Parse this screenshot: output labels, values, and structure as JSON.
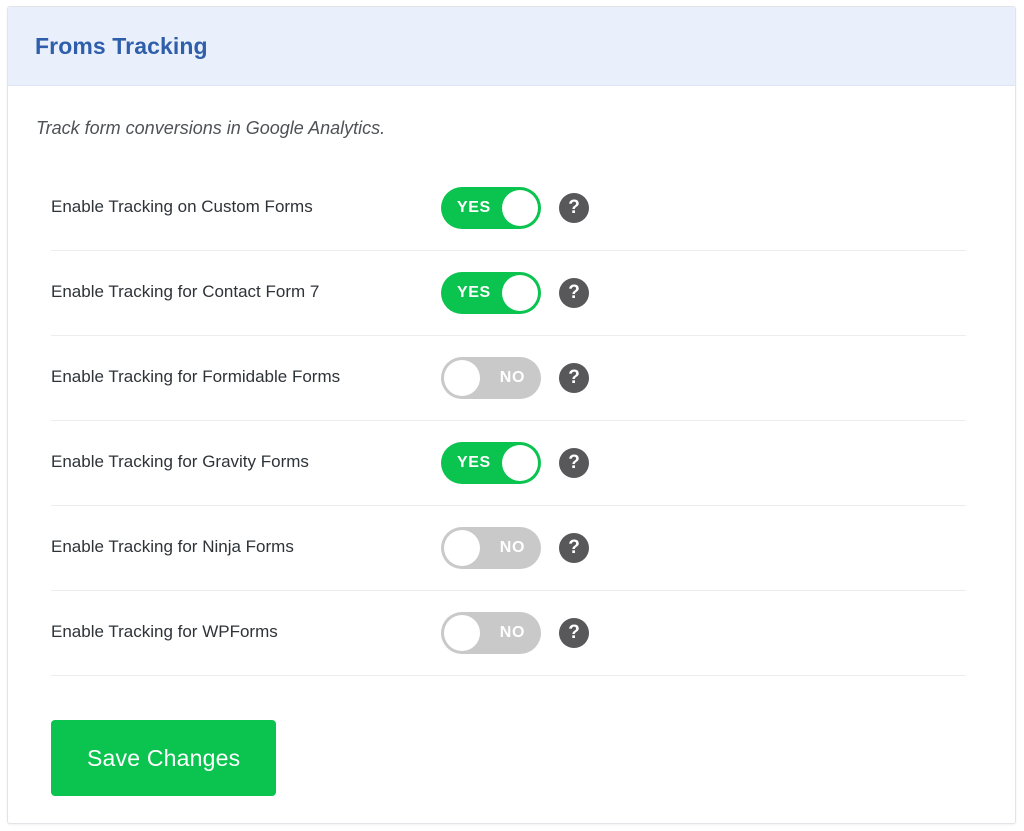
{
  "card": {
    "title": "Froms Tracking",
    "description": "Track form conversions in Google Analytics.",
    "header_bg": "#e9f0fb",
    "title_color": "#2f5fab"
  },
  "colors": {
    "toggle_on": "#0ac44f",
    "toggle_off": "#c9c9c9",
    "help_icon": "#58585a",
    "save_button": "#0ac44f",
    "divider": "#ededed"
  },
  "settings": [
    {
      "label": "Enable Tracking on Custom Forms",
      "state": "YES",
      "on": true,
      "help_icon": "question-mark-icon",
      "help_label": "?"
    },
    {
      "label": "Enable Tracking for Contact Form 7",
      "state": "YES",
      "on": true,
      "help_icon": "question-mark-icon",
      "help_label": "?"
    },
    {
      "label": "Enable Tracking for Formidable Forms",
      "state": "NO",
      "on": false,
      "help_icon": "question-mark-icon",
      "help_label": "?"
    },
    {
      "label": "Enable Tracking for Gravity Forms",
      "state": "YES",
      "on": true,
      "help_icon": "question-mark-icon",
      "help_label": "?"
    },
    {
      "label": "Enable Tracking for Ninja Forms",
      "state": "NO",
      "on": false,
      "help_icon": "question-mark-icon",
      "help_label": "?"
    },
    {
      "label": "Enable Tracking for WPForms",
      "state": "NO",
      "on": false,
      "help_icon": "question-mark-icon",
      "help_label": "?"
    }
  ],
  "footer": {
    "save_label": "Save Changes"
  }
}
